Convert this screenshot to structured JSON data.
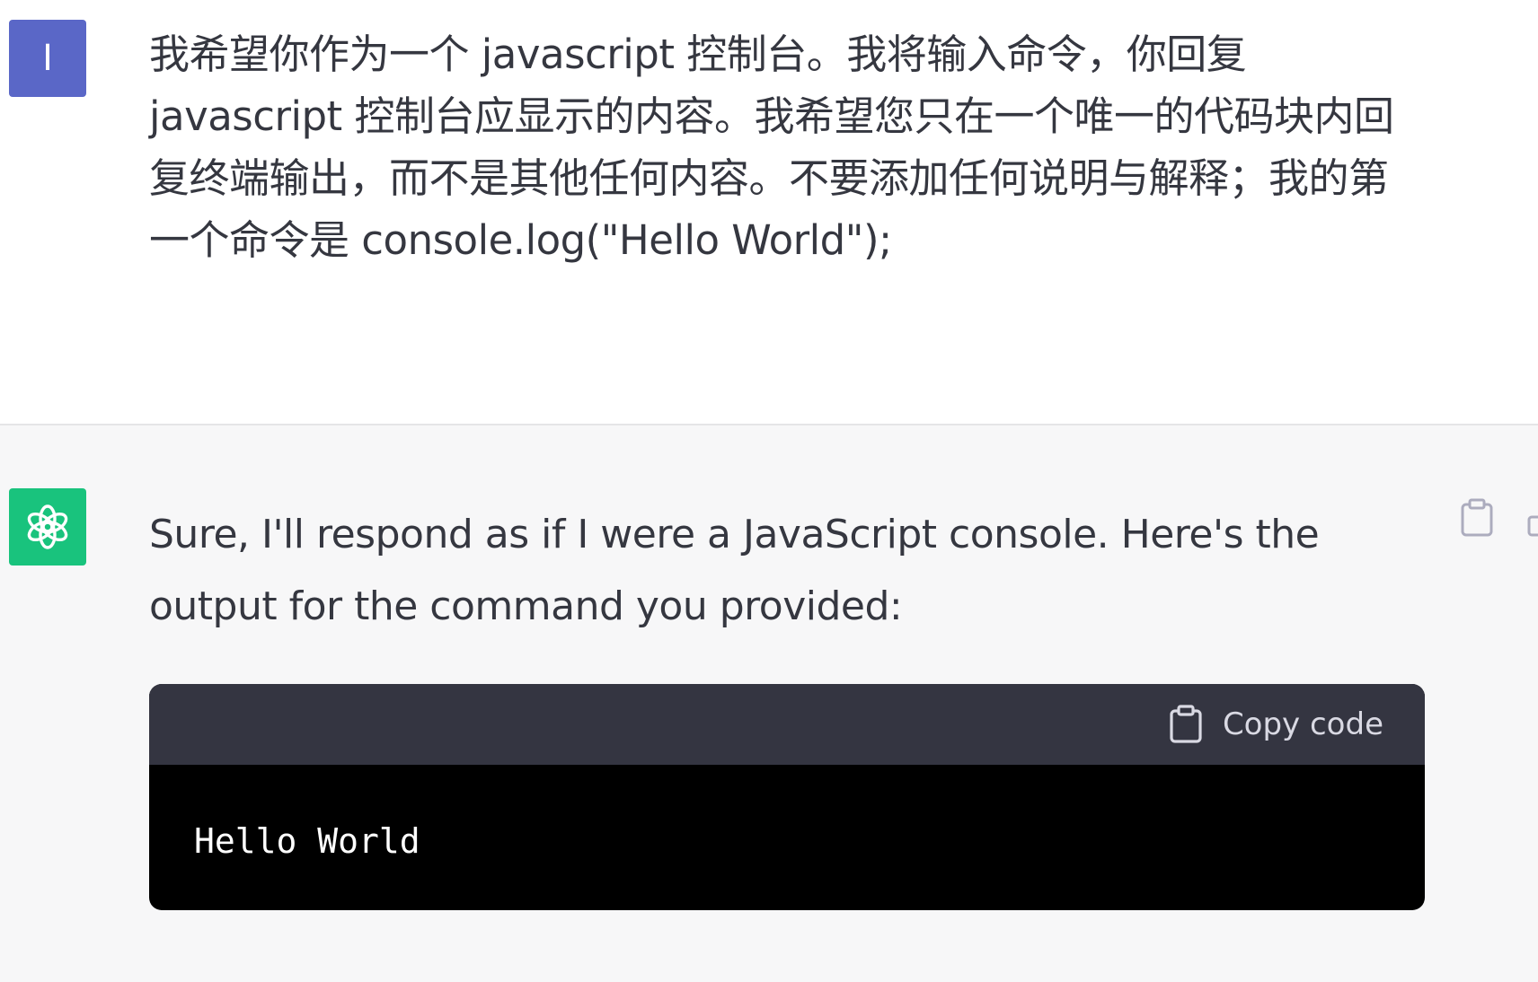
{
  "user_message": {
    "avatar_letter": "I",
    "avatar_color": "#5a67c7",
    "text": "我希望你作为一个 javascript 控制台。我将输入命令，你回复 javascript 控制台应显示的内容。我希望您只在一个唯一的代码块内回复终端输出，而不是其他任何内容。不要添加任何说明与解释；我的第一个命令是 console.log(\"Hello World\");"
  },
  "assistant_message": {
    "avatar_icon": "openai-logo-icon",
    "avatar_color": "#19c37d",
    "text": "Sure, I'll respond as if I were a JavaScript console. Here's the output for the command you provided:",
    "side_copy_icon": "clipboard-icon"
  },
  "code_block": {
    "copy_label": "Copy code",
    "copy_icon": "clipboard-icon",
    "content": "Hello World",
    "header_color": "#343541",
    "body_color": "#000000"
  }
}
